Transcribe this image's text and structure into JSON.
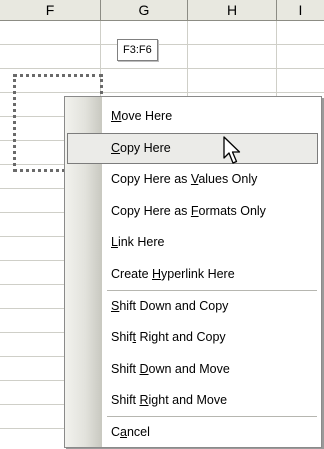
{
  "columns": {
    "f": "F",
    "g": "G",
    "h": "H",
    "i": "I"
  },
  "range_tooltip": "F3:F6",
  "context_menu": {
    "items": [
      {
        "pre": "",
        "key": "M",
        "post": "ove Here"
      },
      {
        "pre": "",
        "key": "C",
        "post": "opy Here"
      },
      {
        "pre": "Copy Here as ",
        "key": "V",
        "post": "alues Only"
      },
      {
        "pre": "Copy Here as ",
        "key": "F",
        "post": "ormats Only"
      },
      {
        "pre": "",
        "key": "L",
        "post": "ink Here"
      },
      {
        "pre": "Create ",
        "key": "H",
        "post": "yperlink Here"
      },
      {
        "pre": "",
        "key": "S",
        "post": "hift Down and Copy"
      },
      {
        "pre": "Shif",
        "key": "t",
        "post": " Right and Copy"
      },
      {
        "pre": "Shift ",
        "key": "D",
        "post": "own and Move"
      },
      {
        "pre": "Shift ",
        "key": "R",
        "post": "ight and Move"
      },
      {
        "pre": "C",
        "key": "a",
        "post": "ncel"
      }
    ],
    "active_index": 1
  },
  "icons": {
    "cursor": "arrow-cursor-icon"
  }
}
